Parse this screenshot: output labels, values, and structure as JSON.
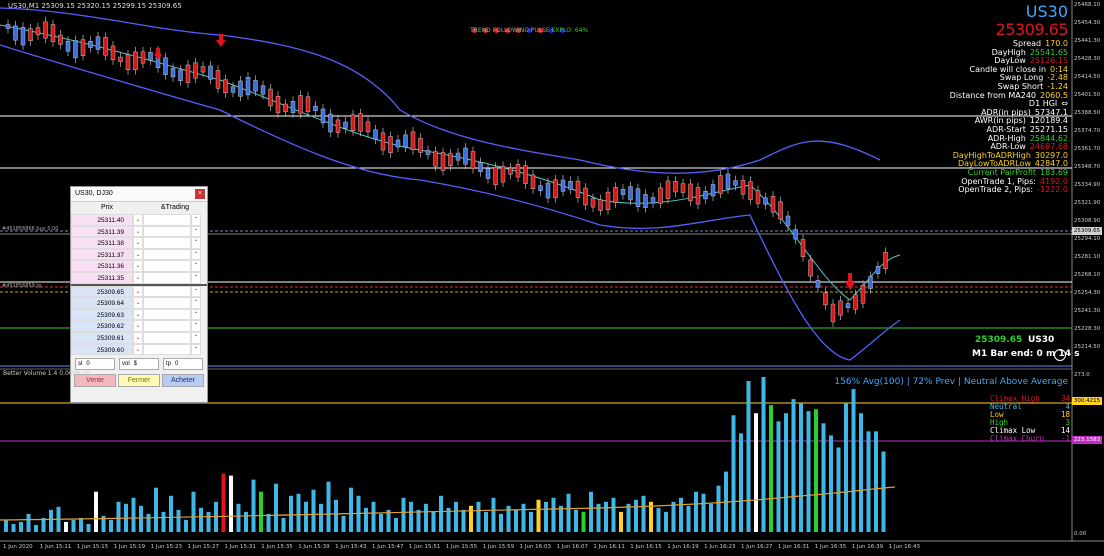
{
  "window": {
    "title": "US30,M1  25309.15 25320.15 25299.15 25309.65"
  },
  "pulse": {
    "label": "TREND FOLLOWING PULSE",
    "explo": "EXPLO: 64%",
    "dots": [
      "#e22",
      "#e22",
      "#e22",
      "#e22",
      "#e22",
      "#22e",
      "#e22",
      "#22e",
      "#22e"
    ]
  },
  "header": {
    "symbol": "US30",
    "price": "25309.65"
  },
  "stats": [
    {
      "label": "Spread",
      "value": "170.0",
      "color": "#ffd21f"
    },
    {
      "label": "DayHigh",
      "value": "25541.65",
      "color": "#2bd12b"
    },
    {
      "label": "DayLow",
      "value": "25126.15",
      "color": "#e0141c"
    },
    {
      "label": "Candle will close in",
      "value": "0:14",
      "color": "#ffd21f"
    },
    {
      "label": "Swap Long",
      "value": "-2.48",
      "color": "#ffd21f"
    },
    {
      "label": "Swap Short",
      "value": "-1.24",
      "color": "#ffd21f"
    },
    {
      "label": "Distance from MA240",
      "value": "2060.5",
      "color": "#ffd21f"
    },
    {
      "label": "D1 HGI",
      "value": "⇔",
      "color": "#fff"
    },
    {
      "label": "ADR(in pips)",
      "value": "57347.1",
      "color": "#fff"
    },
    {
      "label": "AWR(in pips)",
      "value": "120189.4",
      "color": "#fff"
    },
    {
      "label": "ADR-Start",
      "value": "25271.15",
      "color": "#fff"
    },
    {
      "label": "ADR-High",
      "value": "25844.62",
      "color": "#2bd12b"
    },
    {
      "label": "ADR-Low",
      "value": "24697.68",
      "color": "#e0141c"
    },
    {
      "label": "DayHighToADRHigh",
      "value": "30297.0",
      "color": "#ffd21f",
      "labelColor": "#ffd21f"
    },
    {
      "label": "DayLowToADRLow",
      "value": "42847.0",
      "color": "#ffd21f",
      "labelColor": "#ffd21f"
    },
    {
      "label": "Current PairProfit",
      "value": "183.69",
      "color": "#2bd12b",
      "labelColor": "#2bd12b"
    },
    {
      "label": "OpenTrade 1, Pips:",
      "value": "4192.0",
      "color": "#e0141c"
    },
    {
      "label": "OpenTrade 2, Pips:",
      "value": "-1222.0",
      "color": "#e0141c"
    }
  ],
  "ticket": {
    "title": "US30, DJ30",
    "close_glyph": "×",
    "col_price": "Prix",
    "col_trading": "&Trading",
    "asks": [
      "25311.40",
      "25311.39",
      "25311.38",
      "25311.37",
      "25311.36",
      "25311.35"
    ],
    "bids": [
      "25309.65",
      "25309.64",
      "25309.63",
      "25309.62",
      "25309.61",
      "25309.60"
    ],
    "dd_glyph": "⌄",
    "ud_glyph": "⌃",
    "ctrl_sl": "sl",
    "ctrl_sl_val": "0",
    "ctrl_vol": "vol",
    "ctrl_vol_val": "$",
    "ctrl_tp": "tp",
    "ctrl_tp_val": "0",
    "sell": "Vente",
    "close": "Fermer",
    "buy": "Acheter"
  },
  "tags": {
    "price": "25309.65",
    "symbol": "US30",
    "bar_end": "M1 Bar end: 0 m 14 s"
  },
  "volume": {
    "title": "Better Volume 1.4  0.0000 16...",
    "avg_text": "156% Avg(100) | 72% Prev | Neutral Above Average",
    "legend": [
      {
        "label": "Climax High",
        "value": "34",
        "color": "#e0141c"
      },
      {
        "label": "Neutral",
        "value": "4",
        "color": "#3fb7e6"
      },
      {
        "label": "Low",
        "value": "18",
        "color": "#ffd21f"
      },
      {
        "label": "High",
        "value": "3",
        "color": "#2bd12b"
      },
      {
        "label": "Climax Low",
        "value": "14",
        "color": "#fff"
      },
      {
        "label": "Climax Churn",
        "value": "-1",
        "color": "#c22cc2"
      }
    ]
  },
  "line_labels": {
    "buy_line": "#451856866 buy 5.00",
    "tp_line": "#451856859 tp"
  },
  "yaxis": [
    "25468.10",
    "25454.30",
    "25441.30",
    "25428.30",
    "25414.50",
    "25401.50",
    "25388.50",
    "25374.70",
    "25361.70",
    "25348.70",
    "25334.90",
    "25321.90",
    "25308.90",
    "25294.10",
    "25281.10",
    "25268.10",
    "25254.30",
    "25241.30",
    "25228.30",
    "25214.50"
  ],
  "price_boxes": [
    {
      "value": "25309.65",
      "bg": "#d0d0d0",
      "fg": "#000"
    },
    {
      "value": "300.4215",
      "bg": "#ffd21f",
      "fg": "#000"
    },
    {
      "value": "223.1583",
      "bg": "#c22cc2",
      "fg": "#fff"
    }
  ],
  "vol_axis": [
    "273.0",
    "0.00"
  ],
  "xaxis": [
    "1 Jun 2020",
    "1 Jun 15:11",
    "1 Jun 15:15",
    "1 Jun 15:19",
    "1 Jun 15:23",
    "1 Jun 15:27",
    "1 Jun 15:31",
    "1 Jun 15:35",
    "1 Jun 15:39",
    "1 Jun 15:43",
    "1 Jun 15:47",
    "1 Jun 15:51",
    "1 Jun 15:55",
    "1 Jun 15:59",
    "1 Jun 16:03",
    "1 Jun 16:07",
    "1 Jun 16:11",
    "1 Jun 16:15",
    "1 Jun 16:19",
    "1 Jun 16:23",
    "1 Jun 16:27",
    "1 Jun 16:31",
    "1 Jun 16:35",
    "1 Jun 16:39",
    "1 Jun 16:43"
  ],
  "colors": {
    "up": "#3b6fe0",
    "down": "#d01919",
    "band": "#5560ff",
    "level": "#ffffff",
    "vol": "#3fb7e6"
  },
  "chart_data": {
    "type": "bar",
    "title": "",
    "series": [
      {
        "values": [
          12,
          8,
          10,
          18,
          7,
          14,
          22,
          25,
          10,
          12,
          14,
          8,
          40,
          16,
          12,
          30,
          28,
          34,
          26,
          18,
          44,
          20,
          36,
          22,
          12,
          40,
          24,
          20,
          30,
          58,
          56,
          28,
          20,
          52,
          40,
          18,
          48,
          14,
          36,
          38,
          30,
          42,
          28,
          50,
          32,
          16,
          44,
          36,
          24,
          30,
          18,
          22,
          14,
          34,
          30,
          22,
          28,
          20,
          36,
          24,
          30,
          22,
          26,
          30,
          20,
          34,
          18,
          26,
          22,
          28,
          20,
          32,
          30,
          34,
          26,
          38,
          22,
          20,
          40,
          28,
          30,
          34,
          20,
          28,
          32,
          36,
          30,
          24,
          20,
          30,
          34,
          26,
          40,
          38,
          28,
          46,
          60,
          116,
          98,
          150,
          118,
          154,
          126,
          110,
          118,
          132,
          128,
          120,
          122,
          108,
          96,
          84,
          128,
          142,
          118,
          100,
          100,
          80
        ],
        "colors": [
          "n",
          "n",
          "n",
          "n",
          "n",
          "n",
          "n",
          "n",
          "w",
          "n",
          "n",
          "n",
          "w",
          "n",
          "n",
          "n",
          "n",
          "n",
          "n",
          "n",
          "n",
          "n",
          "n",
          "n",
          "n",
          "n",
          "n",
          "n",
          "n",
          "r",
          "w",
          "n",
          "n",
          "n",
          "g",
          "n",
          "n",
          "n",
          "n",
          "n",
          "n",
          "n",
          "n",
          "n",
          "n",
          "n",
          "n",
          "n",
          "n",
          "n",
          "n",
          "n",
          "n",
          "n",
          "n",
          "n",
          "n",
          "n",
          "n",
          "n",
          "n",
          "n",
          "y",
          "n",
          "n",
          "n",
          "n",
          "n",
          "n",
          "n",
          "n",
          "y",
          "n",
          "n",
          "n",
          "n",
          "n",
          "g",
          "n",
          "n",
          "n",
          "n",
          "y",
          "n",
          "n",
          "n",
          "y",
          "n",
          "n",
          "n",
          "n",
          "n",
          "n",
          "n",
          "n",
          "n",
          "n",
          "n",
          "n",
          "n",
          "w",
          "n",
          "g",
          "n",
          "n",
          "n",
          "n",
          "n",
          "g",
          "n",
          "n",
          "n",
          "n",
          "n",
          "n",
          "n",
          "n",
          "n"
        ]
      }
    ]
  }
}
